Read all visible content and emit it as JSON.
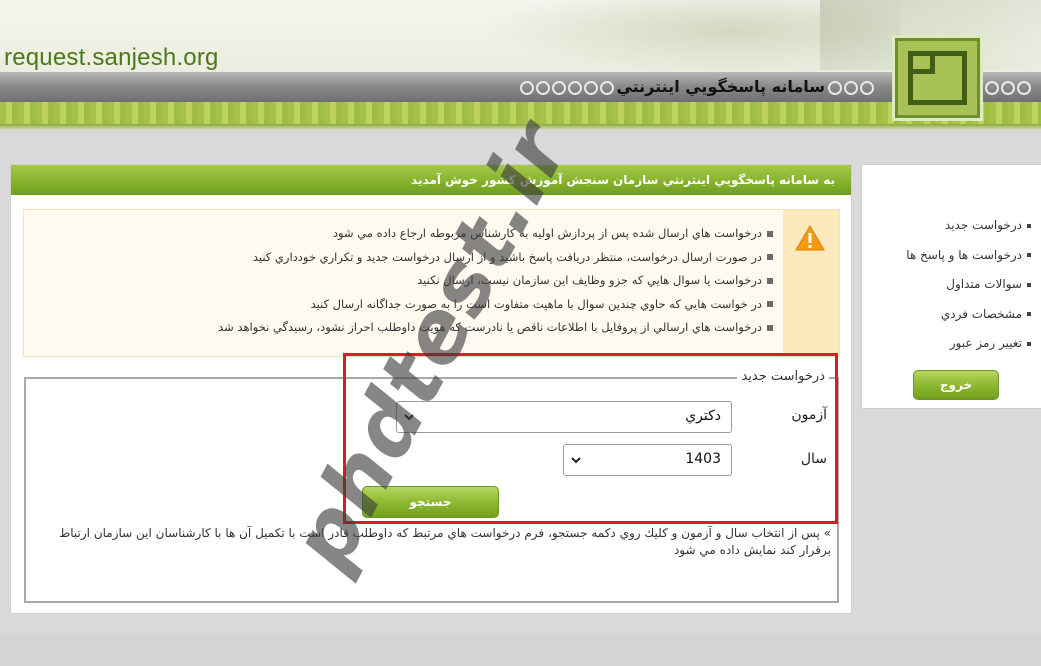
{
  "header": {
    "site_url": "request.sanjesh.org",
    "system_title": "سامانه پاسخگويي اينترنتي"
  },
  "main": {
    "welcome": "به سامانه پاسخگويي اينترنتي سازمان سنجش آموزش كشور خوش آمديد",
    "notices": [
      "درخواست هاي ارسال شده پس از پردازش اوليه به كارشناس مربوطه ارجاع داده مي شود",
      "در صورت ارسال درخواست، منتظر دريافت پاسخ باشيد و از ارسال درخواست جديد و تكراري خودداري كنيد",
      "درخواست يا سوال هايي كه جزو وظايف اين سازمان نيست، ارسال نكنيد",
      "در خواست هايي كه حاوي چندين سوال با ماهيت متفاوت است را به صورت جداگانه ارسال كنيد",
      "درخواست هاي ارسالي از پروفايل با اطلاعات ناقص يا نادرست كه هويت داوطلب احراز نشود، رسيدگي نخواهد شد"
    ],
    "form": {
      "legend": "درخواست جديد",
      "exam_label": "آزمون",
      "exam_value": "دكتري",
      "year_label": "سال",
      "year_value": "1403",
      "search_label": "جستجو",
      "hint": "» پس از انتخاب سال و آزمون و كليك روي دكمه جستجو، فرم درخواست هاي مرتبط كه داوطلب قادر است با تكميل آن ها با كارشناسان اين سازمان ارتباط برقرار كند نمايش داده مي شود"
    }
  },
  "sidebar": {
    "items": [
      "درخواست جديد",
      "درخواست ها و پاسخ ها",
      "سوالات متداول",
      "مشخصات فردي",
      "تغيير رمز عبور"
    ],
    "exit_label": "خروج"
  },
  "watermark": "phdtest.ir",
  "colors": {
    "brand_green": "#86b32d",
    "url_green": "#4a7a17",
    "highlight_red": "#d21f2a",
    "warning_orange": "#f39c12"
  },
  "icons": [
    "warning-icon",
    "chevron-down-icon",
    "logo-emblem"
  ]
}
